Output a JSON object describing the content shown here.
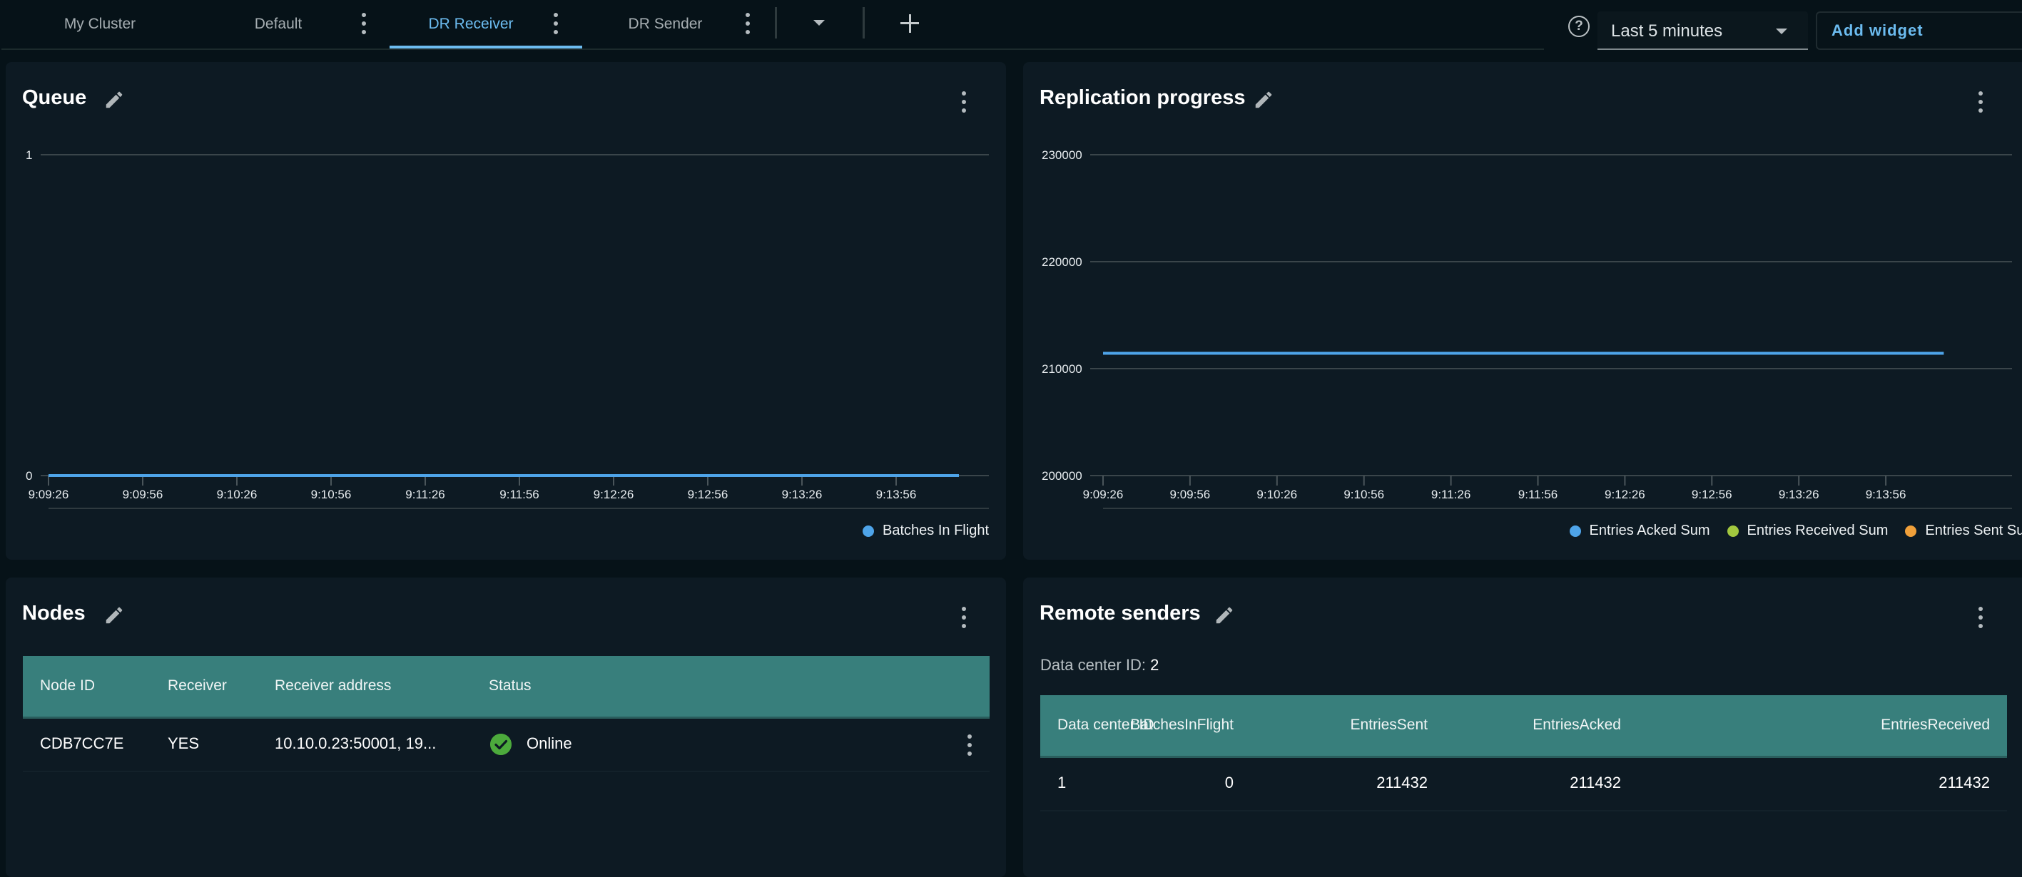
{
  "tabs": [
    {
      "label": "My Cluster",
      "active": false,
      "has_menu": false
    },
    {
      "label": "Default",
      "active": false,
      "has_menu": true
    },
    {
      "label": "DR Receiver",
      "active": true,
      "has_menu": true
    },
    {
      "label": "DR Sender",
      "active": false,
      "has_menu": true
    }
  ],
  "toolbar": {
    "more_tabs_icon": "caret-down-icon",
    "add_tab_icon": "plus-icon",
    "help_icon": "?",
    "time_range": {
      "selected": "Last 5 minutes"
    },
    "add_widget_label": "Add widget"
  },
  "colors": {
    "accent": "#6cbcf0",
    "series_blue": "#4ea4e9",
    "series_green": "#a3c83f",
    "series_orange": "#f0a03a",
    "table_header": "#387f7c",
    "status_online": "#4caa3c"
  },
  "queue_panel": {
    "title": "Queue",
    "chart_data": {
      "type": "line",
      "title": "Queue",
      "xlabel": "",
      "ylabel": "",
      "x_tick_labels": [
        "9:09:26",
        "9:09:56",
        "9:10:26",
        "9:10:56",
        "9:11:26",
        "9:11:56",
        "9:12:26",
        "9:12:56",
        "9:13:26",
        "9:13:56"
      ],
      "y_tick_labels": [
        "0",
        "1"
      ],
      "ylim": [
        0,
        1
      ],
      "x_range_seconds": [
        0,
        300
      ],
      "grid": true,
      "legend_position": "bottom-right",
      "series": [
        {
          "name": "Batches In Flight",
          "color": "#4ea4e9",
          "x_seconds": [
            0,
            290
          ],
          "values": [
            0,
            0
          ]
        }
      ]
    }
  },
  "replication_panel": {
    "title": "Replication progress",
    "chart_data": {
      "type": "line",
      "title": "Replication progress",
      "xlabel": "",
      "ylabel": "",
      "x_tick_labels": [
        "9:09:26",
        "9:09:56",
        "9:10:26",
        "9:10:56",
        "9:11:26",
        "9:11:56",
        "9:12:26",
        "9:12:56",
        "9:13:26",
        "9:13:56"
      ],
      "y_tick_labels": [
        "200000",
        "210000",
        "220000",
        "230000"
      ],
      "ylim": [
        200000,
        230000
      ],
      "x_range_seconds": [
        0,
        300
      ],
      "grid": true,
      "legend_position": "bottom-right",
      "series": [
        {
          "name": "Entries Acked Sum",
          "color": "#4ea4e9",
          "x_seconds": [
            0,
            290
          ],
          "values": [
            211432,
            211432
          ]
        },
        {
          "name": "Entries Received Sum",
          "color": "#a3c83f",
          "x_seconds": [],
          "values": []
        },
        {
          "name": "Entries Sent Sum",
          "color": "#f0a03a",
          "x_seconds": [],
          "values": []
        }
      ]
    }
  },
  "nodes_panel": {
    "title": "Nodes",
    "columns": [
      "Node ID",
      "Receiver",
      "Receiver address",
      "Status"
    ],
    "rows": [
      {
        "node_id": "CDB7CC7E",
        "receiver": "YES",
        "receiver_address": "10.10.0.23:50001, 19...",
        "status": "Online"
      }
    ]
  },
  "remote_senders_panel": {
    "title": "Remote senders",
    "dc_label": "Data center ID:",
    "dc_value": "2",
    "columns": [
      "Data center ID",
      "BatchesInFlight",
      "EntriesSent",
      "EntriesAcked",
      "EntriesReceived"
    ],
    "rows": [
      {
        "data_center_id": "1",
        "batches_in_flight": "0",
        "entries_sent": "211432",
        "entries_acked": "211432",
        "entries_received": "211432"
      }
    ]
  }
}
